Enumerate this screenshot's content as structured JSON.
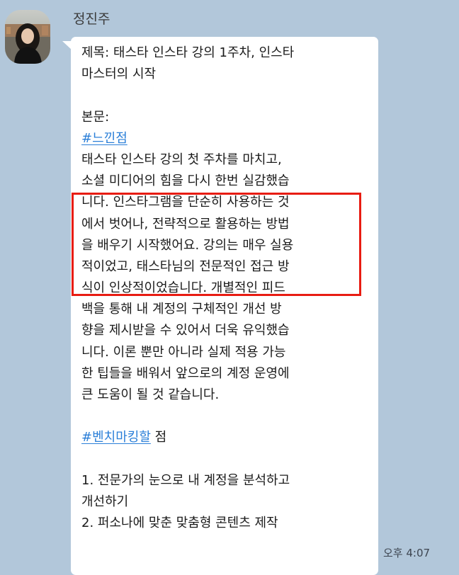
{
  "sender": {
    "name": "정진주"
  },
  "message": {
    "lines": [
      {
        "text": "제목: 태스타 인스타 강의 1주차, 인스타"
      },
      {
        "text": "마스터의 시작"
      },
      {
        "text": ""
      },
      {
        "text": "본문:"
      },
      {
        "tag": "#느낀점"
      },
      {
        "text": "태스타 인스타 강의 첫 주차를 마치고,"
      },
      {
        "text": "소셜 미디어의 힘을 다시 한번 실감했습"
      },
      {
        "text": "니다. 인스타그램을 단순히 사용하는 것"
      },
      {
        "text": "에서 벗어나, 전략적으로 활용하는 방법"
      },
      {
        "text": "을 배우기 시작했어요. 강의는 매우 실용"
      },
      {
        "text": "적이었고, 태스타님의 전문적인 접근 방"
      },
      {
        "text": "식이 인상적이었습니다. 개별적인 피드"
      },
      {
        "text": "백을 통해 내 계정의 구체적인 개선 방"
      },
      {
        "text": "향을 제시받을 수 있어서 더욱 유익했습"
      },
      {
        "text": "니다. 이론 뿐만 아니라 실제 적용 가능"
      },
      {
        "text": "한 팁들을 배워서 앞으로의 계정 운영에"
      },
      {
        "text": " 큰 도움이 될 것 같습니다."
      },
      {
        "text": ""
      },
      {
        "tag": "#벤치마킹할",
        "text": " 점"
      },
      {
        "text": ""
      },
      {
        "text": "1. 전문가의 눈으로 내 계정을 분석하고"
      },
      {
        "text": "개선하기"
      },
      {
        "text": "2. 퍼소나에 맞춘 맞춤형 콘텐츠 제작"
      }
    ],
    "time": "오후 4:07"
  },
  "colors": {
    "background": "#b2c7da",
    "bubble": "#ffffff",
    "hashtag": "#2b7fd8",
    "highlight": "#e81c12"
  }
}
